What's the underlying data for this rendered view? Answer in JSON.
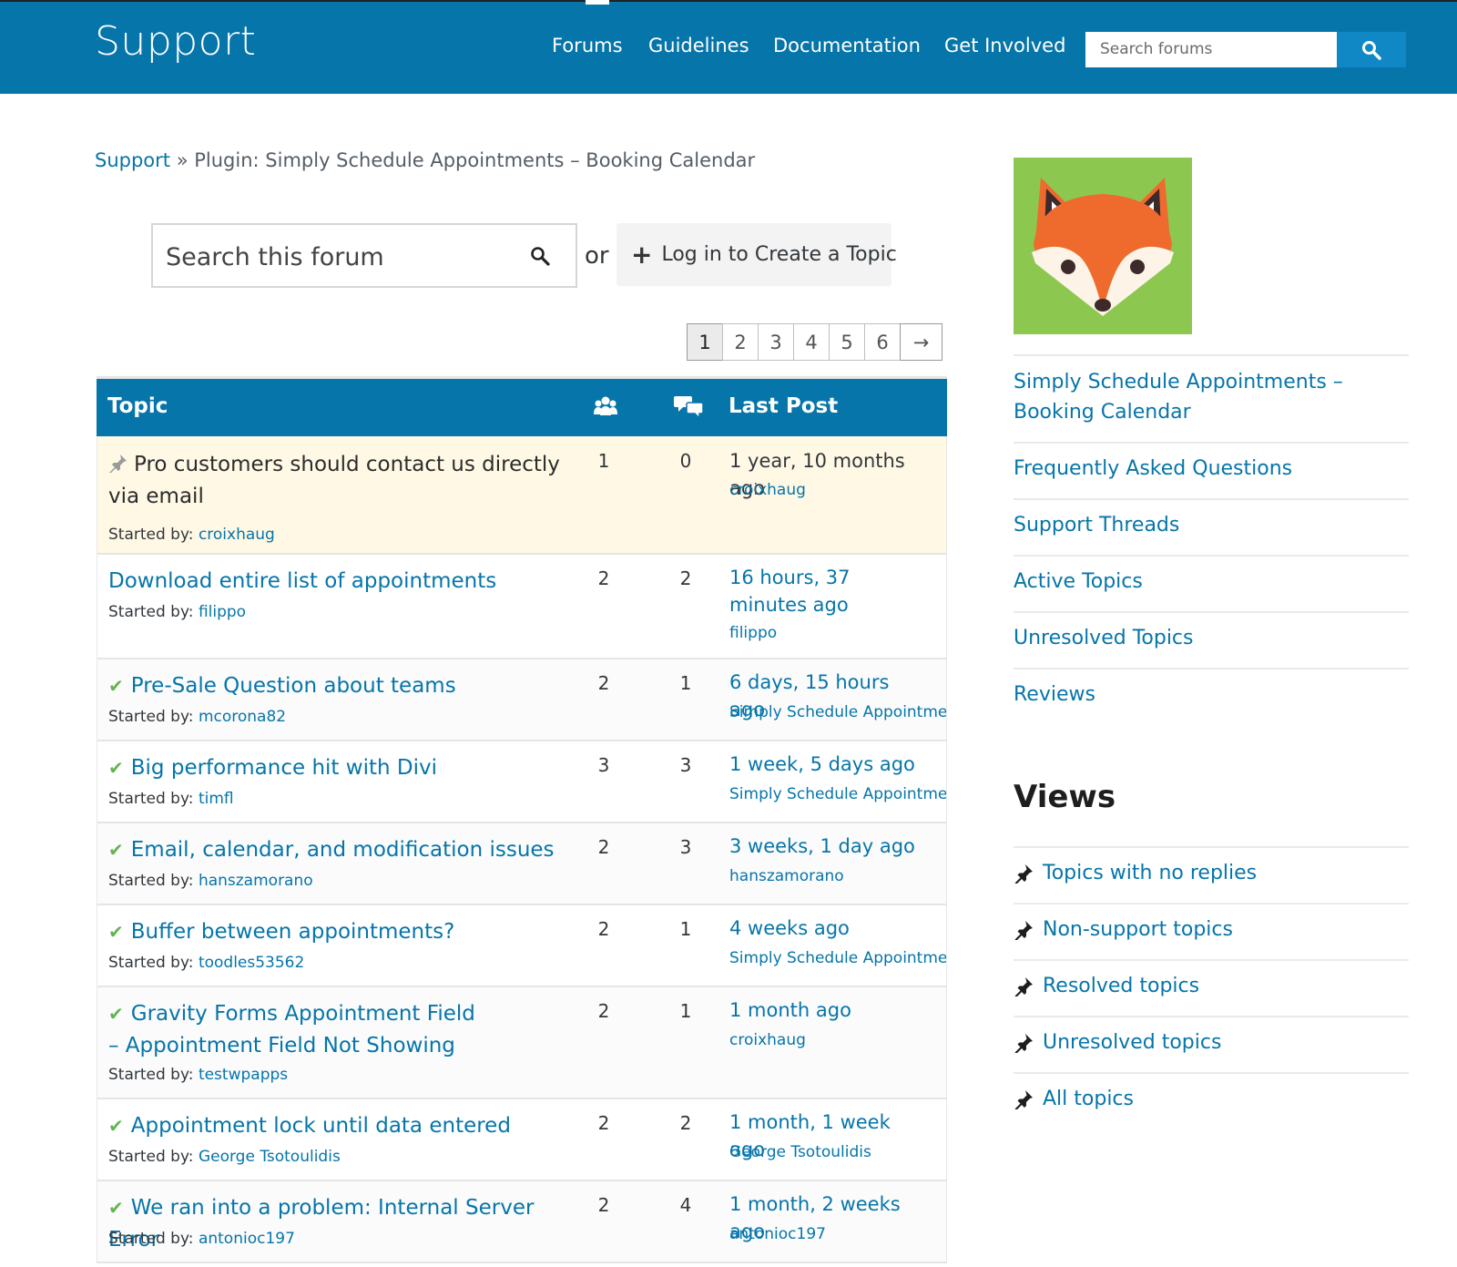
{
  "header": {
    "site_title": "Support",
    "nav": [
      "Forums",
      "Guidelines",
      "Documentation",
      "Get Involved"
    ],
    "search_placeholder": "Search forums",
    "bg_color": "#0675aa"
  },
  "breadcrumb": {
    "root": "Support",
    "separator": "»",
    "current": "Plugin: Simply Schedule Appointments – Booking Calendar"
  },
  "forum_search": {
    "placeholder": "Search this forum",
    "or_label": "or",
    "create_label": "Log in to Create a Topic"
  },
  "pagination": {
    "pages": [
      "1",
      "2",
      "3",
      "4",
      "5",
      "6"
    ],
    "current": "1",
    "next": "→"
  },
  "table": {
    "headers": {
      "topic": "Topic",
      "last_post": "Last Post"
    },
    "started_by_label": "Started by:",
    "rows": [
      {
        "title": "Pro customers should contact us directly via email",
        "author": "croixhaug",
        "voices": "1",
        "replies": "0",
        "last_time": "1 year, 10 months ago",
        "last_by": "croixhaug",
        "status": "sticky"
      },
      {
        "title": "Download entire list of appointments",
        "author": "filippo",
        "voices": "2",
        "replies": "2",
        "last_time": "16 hours, 37 minutes ago",
        "last_by": "filippo",
        "status": "open"
      },
      {
        "title": "Pre-Sale Question about teams",
        "author": "mcorona82",
        "voices": "2",
        "replies": "1",
        "last_time": "6 days, 15 hours ago",
        "last_by": "Simply Schedule Appointments",
        "status": "resolved"
      },
      {
        "title": "Big performance hit with Divi",
        "author": "timfl",
        "voices": "3",
        "replies": "3",
        "last_time": "1 week, 5 days ago",
        "last_by": "Simply Schedule Appointments",
        "status": "resolved"
      },
      {
        "title": "Email, calendar, and modification issues",
        "author": "hanszamorano",
        "voices": "2",
        "replies": "3",
        "last_time": "3 weeks, 1 day ago",
        "last_by": "hanszamorano",
        "status": "resolved"
      },
      {
        "title": "Buffer between appointments?",
        "author": "toodles53562",
        "voices": "2",
        "replies": "1",
        "last_time": "4 weeks ago",
        "last_by": "Simply Schedule Appointments",
        "status": "resolved"
      },
      {
        "title": "Gravity Forms Appointment Field – Appointment Field Not Showing",
        "author": "testwpapps",
        "voices": "2",
        "replies": "1",
        "last_time": "1 month ago",
        "last_by": "croixhaug",
        "status": "resolved"
      },
      {
        "title": "Appointment lock until data entered",
        "author": "George Tsotoulidis",
        "voices": "2",
        "replies": "2",
        "last_time": "1 month, 1 week ago",
        "last_by": "George Tsotoulidis",
        "status": "resolved"
      },
      {
        "title": "We ran into a problem: Internal Server Error",
        "author": "antonioc197",
        "voices": "2",
        "replies": "4",
        "last_time": "1 month, 2 weeks ago",
        "last_by": "antonioc197",
        "status": "resolved"
      }
    ]
  },
  "sidebar": {
    "links": [
      "Simply Schedule Appointments – Booking Calendar",
      "Frequently Asked Questions",
      "Support Threads",
      "Active Topics",
      "Unresolved Topics",
      "Reviews"
    ],
    "views_title": "Views",
    "views": [
      "Topics with no replies",
      "Non-support topics",
      "Resolved topics",
      "Unresolved topics",
      "All topics"
    ]
  }
}
